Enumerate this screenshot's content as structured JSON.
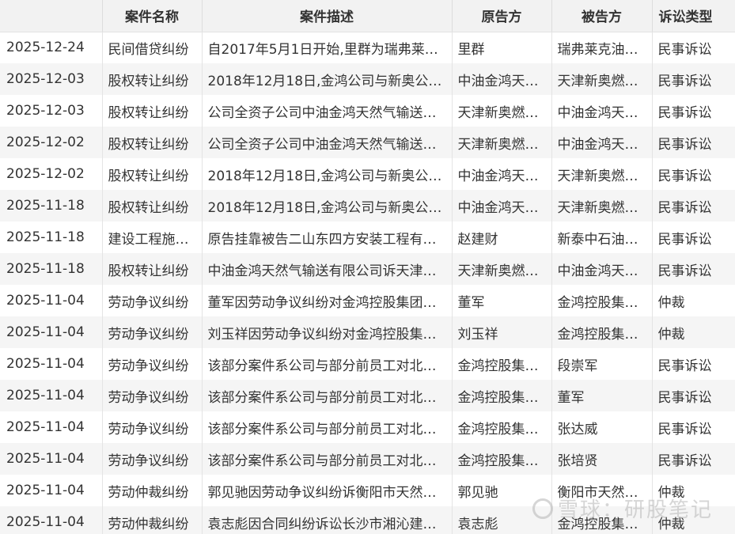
{
  "columns": [
    "",
    "案件名称",
    "案件描述",
    "原告方",
    "被告方",
    "诉讼类型"
  ],
  "rows": [
    {
      "date": "2025-12-24",
      "name": "民间借贷纠纷",
      "desc": "自2017年5月1日开始,里群为瑞弗莱…",
      "plaintiff": "里群",
      "defendant": "瑞弗莱克油…",
      "type": "民事诉讼"
    },
    {
      "date": "2025-12-03",
      "name": "股权转让纠纷",
      "desc": "2018年12月18日,金鸿公司与新奥公…",
      "plaintiff": "中油金鸿天…",
      "defendant": "天津新奥燃…",
      "type": "民事诉讼"
    },
    {
      "date": "2025-12-03",
      "name": "股权转让纠纷",
      "desc": "公司全资子公司中油金鸿天然气输送…",
      "plaintiff": "天津新奥燃…",
      "defendant": "中油金鸿天…",
      "type": "民事诉讼"
    },
    {
      "date": "2025-12-02",
      "name": "股权转让纠纷",
      "desc": "公司全资子公司中油金鸿天然气输送…",
      "plaintiff": "天津新奥燃…",
      "defendant": "中油金鸿天…",
      "type": "民事诉讼"
    },
    {
      "date": "2025-12-02",
      "name": "股权转让纠纷",
      "desc": "2018年12月18日,金鸿公司与新奥公…",
      "plaintiff": "中油金鸿天…",
      "defendant": "天津新奥燃…",
      "type": "民事诉讼"
    },
    {
      "date": "2025-11-18",
      "name": "股权转让纠纷",
      "desc": "2018年12月18日,金鸿公司与新奥公…",
      "plaintiff": "中油金鸿天…",
      "defendant": "天津新奥燃…",
      "type": "民事诉讼"
    },
    {
      "date": "2025-11-18",
      "name": "建设工程施…",
      "desc": "原告挂靠被告二山东四方安装工程有…",
      "plaintiff": "赵建财",
      "defendant": "新泰中石油…",
      "type": "民事诉讼"
    },
    {
      "date": "2025-11-18",
      "name": "股权转让纠纷",
      "desc": "中油金鸿天然气输送有限公司诉天津…",
      "plaintiff": "天津新奥燃…",
      "defendant": "中油金鸿天…",
      "type": "民事诉讼"
    },
    {
      "date": "2025-11-04",
      "name": "劳动争议纠纷",
      "desc": "董军因劳动争议纠纷对金鸿控股集团…",
      "plaintiff": "董军",
      "defendant": "金鸿控股集…",
      "type": "仲裁"
    },
    {
      "date": "2025-11-04",
      "name": "劳动争议纠纷",
      "desc": "刘玉祥因劳动争议纠纷对金鸿控股集…",
      "plaintiff": "刘玉祥",
      "defendant": "金鸿控股集…",
      "type": "仲裁"
    },
    {
      "date": "2025-11-04",
      "name": "劳动争议纠纷",
      "desc": "该部分案件系公司与部分前员工对北…",
      "plaintiff": "金鸿控股集…",
      "defendant": "段崇军",
      "type": "民事诉讼"
    },
    {
      "date": "2025-11-04",
      "name": "劳动争议纠纷",
      "desc": "该部分案件系公司与部分前员工对北…",
      "plaintiff": "金鸿控股集…",
      "defendant": "董军",
      "type": "民事诉讼"
    },
    {
      "date": "2025-11-04",
      "name": "劳动争议纠纷",
      "desc": "该部分案件系公司与部分前员工对北…",
      "plaintiff": "金鸿控股集…",
      "defendant": "张达威",
      "type": "民事诉讼"
    },
    {
      "date": "2025-11-04",
      "name": "劳动争议纠纷",
      "desc": "该部分案件系公司与部分前员工对北…",
      "plaintiff": "金鸿控股集…",
      "defendant": "张培贤",
      "type": "民事诉讼"
    },
    {
      "date": "2025-11-04",
      "name": "劳动仲裁纠纷",
      "desc": "郭见驰因劳动争议纠纷诉衡阳市天然…",
      "plaintiff": "郭见驰",
      "defendant": "衡阳市天然…",
      "type": "仲裁"
    },
    {
      "date": "2025-11-04",
      "name": "劳动仲裁纠纷",
      "desc": "袁志彪因合同纠纷诉讼长沙市湘沁建…",
      "plaintiff": "袁志彪",
      "defendant": "金鸿控股集…",
      "type": "仲裁"
    }
  ],
  "watermark": "雪球：研股笔记"
}
